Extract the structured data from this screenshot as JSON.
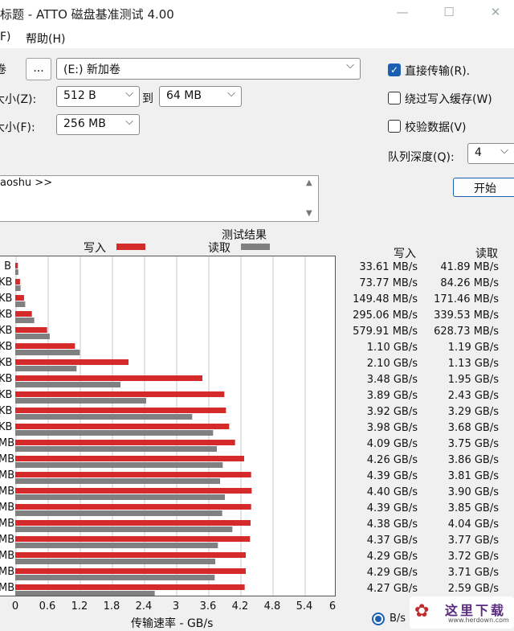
{
  "window": {
    "title": "标题 - ATTO 磁盘基准测试 4.00",
    "minimize_glyph": "—",
    "maximize_glyph": "☐",
    "close_glyph": "✕"
  },
  "menu": {
    "file": "F)",
    "help": "帮助(H)"
  },
  "settings": {
    "drive_label": "卷",
    "browse_label": "...",
    "drive_value": "(E:) 新加卷",
    "io_size_label": "大小(Z):",
    "io_from": "512 B",
    "io_to_label": "到",
    "io_to": "64 MB",
    "file_size_label": "大小(F):",
    "file_size": "256 MB",
    "direct_io_label": "直接传输(R).",
    "bypass_cache_label": "绕过写入缓存(W)",
    "verify_label": "校验数据(V)",
    "queue_depth_label": "队列深度(Q):",
    "queue_depth": "4",
    "start_label": "开始",
    "log_text": "aoshu >>"
  },
  "chart_data": {
    "type": "bar",
    "title": "测试结果",
    "xlabel": "传输速率 - GB/s",
    "xlim": [
      0,
      6
    ],
    "xticks": [
      "0",
      "0.6",
      "1.2",
      "1.8",
      "2.4",
      "3",
      "3.6",
      "4.2",
      "4.8",
      "5.4",
      "6"
    ],
    "categories": [
      "B",
      "KB",
      "KB",
      "KB",
      "KB",
      "KB",
      "KB",
      "KB",
      "KB",
      "KB",
      "KB",
      "MB",
      "MB",
      "MB",
      "MB",
      "MB",
      "MB",
      "MB",
      "MB",
      "MB",
      "MB"
    ],
    "series": [
      {
        "name": "写入",
        "color": "#d42a2a",
        "values": [
          0.034,
          0.074,
          0.149,
          0.295,
          0.58,
          1.1,
          2.1,
          3.48,
          3.89,
          3.92,
          3.98,
          4.09,
          4.26,
          4.39,
          4.4,
          4.39,
          4.38,
          4.37,
          4.29,
          4.29,
          4.27
        ]
      },
      {
        "name": "读取",
        "color": "#808080",
        "values": [
          0.042,
          0.084,
          0.171,
          0.34,
          0.629,
          1.19,
          1.13,
          1.95,
          2.43,
          3.29,
          3.68,
          3.75,
          3.86,
          3.81,
          3.9,
          3.85,
          4.04,
          3.77,
          3.72,
          3.71,
          2.59
        ]
      }
    ],
    "table_headers": {
      "write": "写入",
      "read": "读取"
    },
    "write_text": [
      "33.61 MB/s",
      "73.77 MB/s",
      "149.48 MB/s",
      "295.06 MB/s",
      "579.91 MB/s",
      "1.10 GB/s",
      "2.10 GB/s",
      "3.48 GB/s",
      "3.89 GB/s",
      "3.92 GB/s",
      "3.98 GB/s",
      "4.09 GB/s",
      "4.26 GB/s",
      "4.39 GB/s",
      "4.40 GB/s",
      "4.39 GB/s",
      "4.38 GB/s",
      "4.37 GB/s",
      "4.29 GB/s",
      "4.29 GB/s",
      "4.27 GB/s"
    ],
    "read_text": [
      "41.89 MB/s",
      "84.26 MB/s",
      "171.46 MB/s",
      "339.53 MB/s",
      "628.73 MB/s",
      "1.19 GB/s",
      "1.13 GB/s",
      "1.95 GB/s",
      "2.43 GB/s",
      "3.29 GB/s",
      "3.68 GB/s",
      "3.75 GB/s",
      "3.86 GB/s",
      "3.81 GB/s",
      "3.90 GB/s",
      "3.85 GB/s",
      "4.04 GB/s",
      "3.77 GB/s",
      "3.72 GB/s",
      "3.71 GB/s",
      "2.59 GB/s"
    ]
  },
  "footer": {
    "unit_option": "B/s"
  },
  "watermark": {
    "text": "这里下载",
    "url": "www.herdown.com"
  }
}
